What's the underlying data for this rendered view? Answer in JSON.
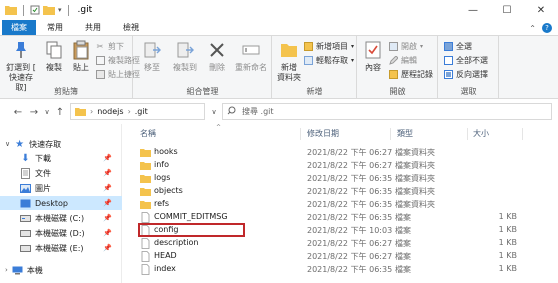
{
  "window": {
    "title": ".git",
    "controls": {
      "minimize": "—",
      "maximize": "☐",
      "close": "✕"
    }
  },
  "tabs": [
    "檔案",
    "常用",
    "共用",
    "檢視"
  ],
  "ribbon": {
    "clipboard": {
      "group_label": "剪貼簿",
      "pin_quick_access": "釘選到 [\n快速存取]",
      "copy": "複製",
      "paste": "貼上",
      "cut": "剪下",
      "copy_path": "複製路徑",
      "paste_shortcut": "貼上捷徑"
    },
    "organize": {
      "group_label": "組合管理",
      "move_to": "移至",
      "copy_to": "複製到",
      "delete": "刪除",
      "rename": "重新命名"
    },
    "new": {
      "group_label": "新增",
      "new_folder": "新增\n資料夾",
      "new_item": "新增項目",
      "easy_access": "輕鬆存取"
    },
    "open": {
      "group_label": "開啟",
      "properties": "內容",
      "open": "開啟",
      "edit": "編輯",
      "history": "歷程記錄"
    },
    "select": {
      "group_label": "選取",
      "select_all": "全選",
      "select_none": "全部不選",
      "invert_selection": "反向選擇"
    }
  },
  "address": {
    "path": [
      "nodejs",
      ".git"
    ],
    "search_placeholder": "搜尋 .git"
  },
  "navpane": {
    "quick_access": "快速存取",
    "items": [
      {
        "label": "下載",
        "pinned": true
      },
      {
        "label": "文件",
        "pinned": true
      },
      {
        "label": "圖片",
        "pinned": true
      },
      {
        "label": "Desktop",
        "pinned": true
      },
      {
        "label": "本機磁碟 (C:)",
        "pinned": true
      },
      {
        "label": "本機磁碟 (D:)",
        "pinned": true
      },
      {
        "label": "本機磁碟 (E:)",
        "pinned": true
      }
    ],
    "this_pc": "本機"
  },
  "columns": {
    "name": "名稱",
    "date": "修改日期",
    "type": "類型",
    "size": "大小"
  },
  "files": [
    {
      "name": "hooks",
      "date": "2021/8/22 下午 06:27",
      "type": "檔案資料夾",
      "size": "",
      "kind": "folder"
    },
    {
      "name": "info",
      "date": "2021/8/22 下午 06:27",
      "type": "檔案資料夾",
      "size": "",
      "kind": "folder"
    },
    {
      "name": "logs",
      "date": "2021/8/22 下午 06:35",
      "type": "檔案資料夾",
      "size": "",
      "kind": "folder"
    },
    {
      "name": "objects",
      "date": "2021/8/22 下午 06:35",
      "type": "檔案資料夾",
      "size": "",
      "kind": "folder"
    },
    {
      "name": "refs",
      "date": "2021/8/22 下午 06:35",
      "type": "檔案資料夾",
      "size": "",
      "kind": "folder"
    },
    {
      "name": "COMMIT_EDITMSG",
      "date": "2021/8/22 下午 06:35",
      "type": "檔案",
      "size": "1 KB",
      "kind": "file"
    },
    {
      "name": "config",
      "date": "2021/8/22 下午 10:03",
      "type": "檔案",
      "size": "1 KB",
      "kind": "file"
    },
    {
      "name": "description",
      "date": "2021/8/22 下午 06:27",
      "type": "檔案",
      "size": "1 KB",
      "kind": "file"
    },
    {
      "name": "HEAD",
      "date": "2021/8/22 下午 06:27",
      "type": "檔案",
      "size": "1 KB",
      "kind": "file"
    },
    {
      "name": "index",
      "date": "2021/8/22 下午 06:35",
      "type": "檔案",
      "size": "1 KB",
      "kind": "file"
    }
  ],
  "colors": {
    "accent": "#1979ca",
    "selection": "#cce8ff",
    "folder": "#f4c34d",
    "highlight": "#c0282a"
  }
}
